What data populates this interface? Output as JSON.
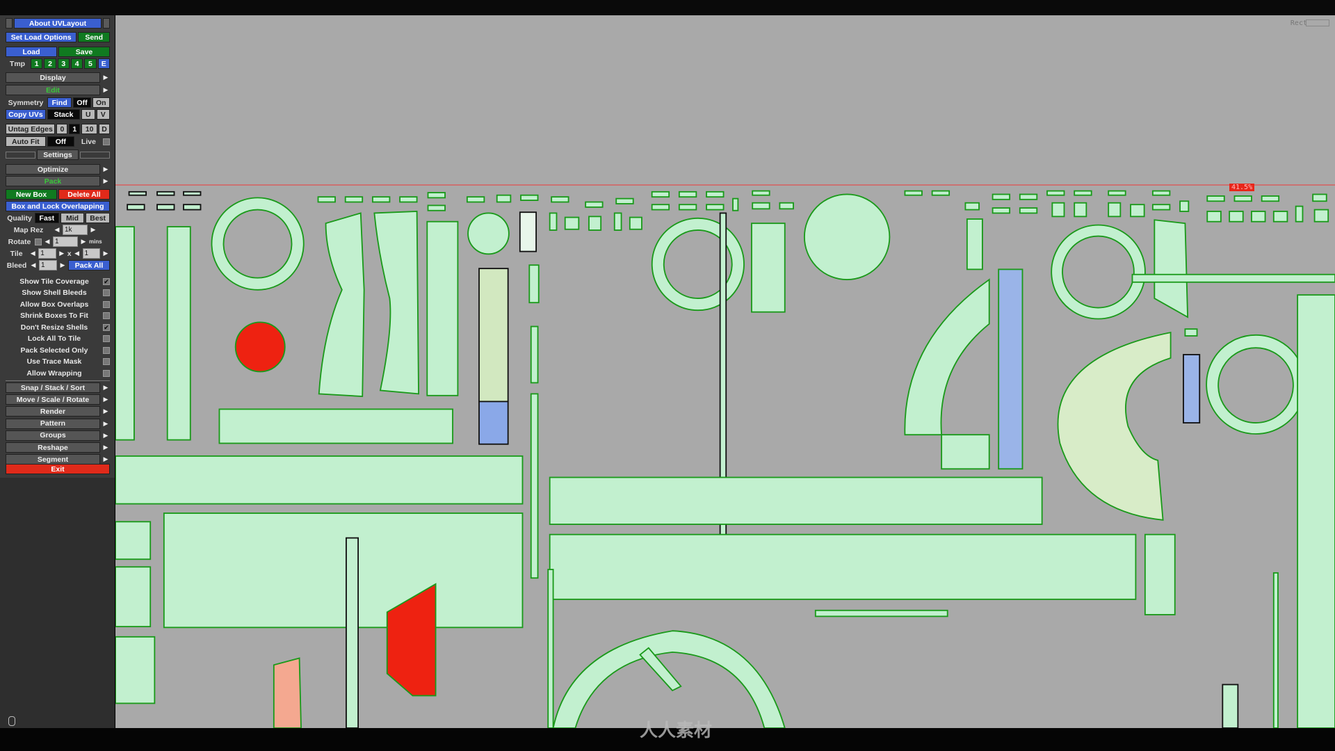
{
  "sidebar": {
    "about": "About UVLayout",
    "set_load_options": "Set Load Options",
    "send": "Send",
    "load": "Load",
    "save": "Save",
    "tmp": {
      "label": "Tmp",
      "slots": [
        "1",
        "2",
        "3",
        "4",
        "5",
        "E"
      ]
    },
    "display": "Display",
    "edit": "Edit",
    "symmetry": {
      "label": "Symmetry",
      "find": "Find",
      "off": "Off",
      "on": "On"
    },
    "copy_uvs": {
      "label": "Copy UVs",
      "stack": "Stack",
      "u": "U",
      "v": "V"
    },
    "untag_edges": {
      "label": "Untag Edges",
      "opts": [
        "0",
        "1",
        "10",
        "D"
      ]
    },
    "auto_fit": {
      "label": "Auto Fit",
      "value": "Off",
      "live": "Live"
    },
    "settings": "Settings",
    "optimize": "Optimize",
    "pack": "Pack",
    "new_box": "New Box",
    "delete_all": "Delete All",
    "box_lock": "Box and Lock Overlapping",
    "quality": {
      "label": "Quality",
      "fast": "Fast",
      "mid": "Mid",
      "best": "Best"
    },
    "map_rez": {
      "label": "Map Rez",
      "value": "1k"
    },
    "rotate": {
      "label": "Rotate",
      "value": "1",
      "unit": "mins"
    },
    "tile": {
      "label": "Tile",
      "x": "1",
      "sep": "x",
      "y": "1"
    },
    "bleed": {
      "label": "Bleed",
      "value": "1",
      "pack_all": "Pack All"
    },
    "options": [
      {
        "label": "Show Tile Coverage",
        "checked": true
      },
      {
        "label": "Show Shell Bleeds",
        "checked": false
      },
      {
        "label": "Allow Box Overlaps",
        "checked": false
      },
      {
        "label": "Shrink Boxes To Fit",
        "checked": false
      },
      {
        "label": "Don't Resize Shells",
        "checked": true
      },
      {
        "label": "Lock All To Tile",
        "checked": false
      },
      {
        "label": "Pack Selected Only",
        "checked": false
      },
      {
        "label": "Use Trace Mask",
        "checked": false
      },
      {
        "label": "Allow Wrapping",
        "checked": false
      }
    ],
    "menus": [
      "Snap / Stack / Sort",
      "Move / Scale / Rotate",
      "Render",
      "Pattern",
      "Groups",
      "Reshape",
      "Segment"
    ],
    "exit": "Exit"
  },
  "viewport": {
    "rect_label": "Rect",
    "coverage": "41.5%",
    "watermark_bottom": "人人素材",
    "colors": {
      "shell_fill": "#c2f0cf",
      "shell_edge": "#1a9a1a",
      "selected": "#ee2211",
      "background": "#a9a9a9"
    }
  }
}
